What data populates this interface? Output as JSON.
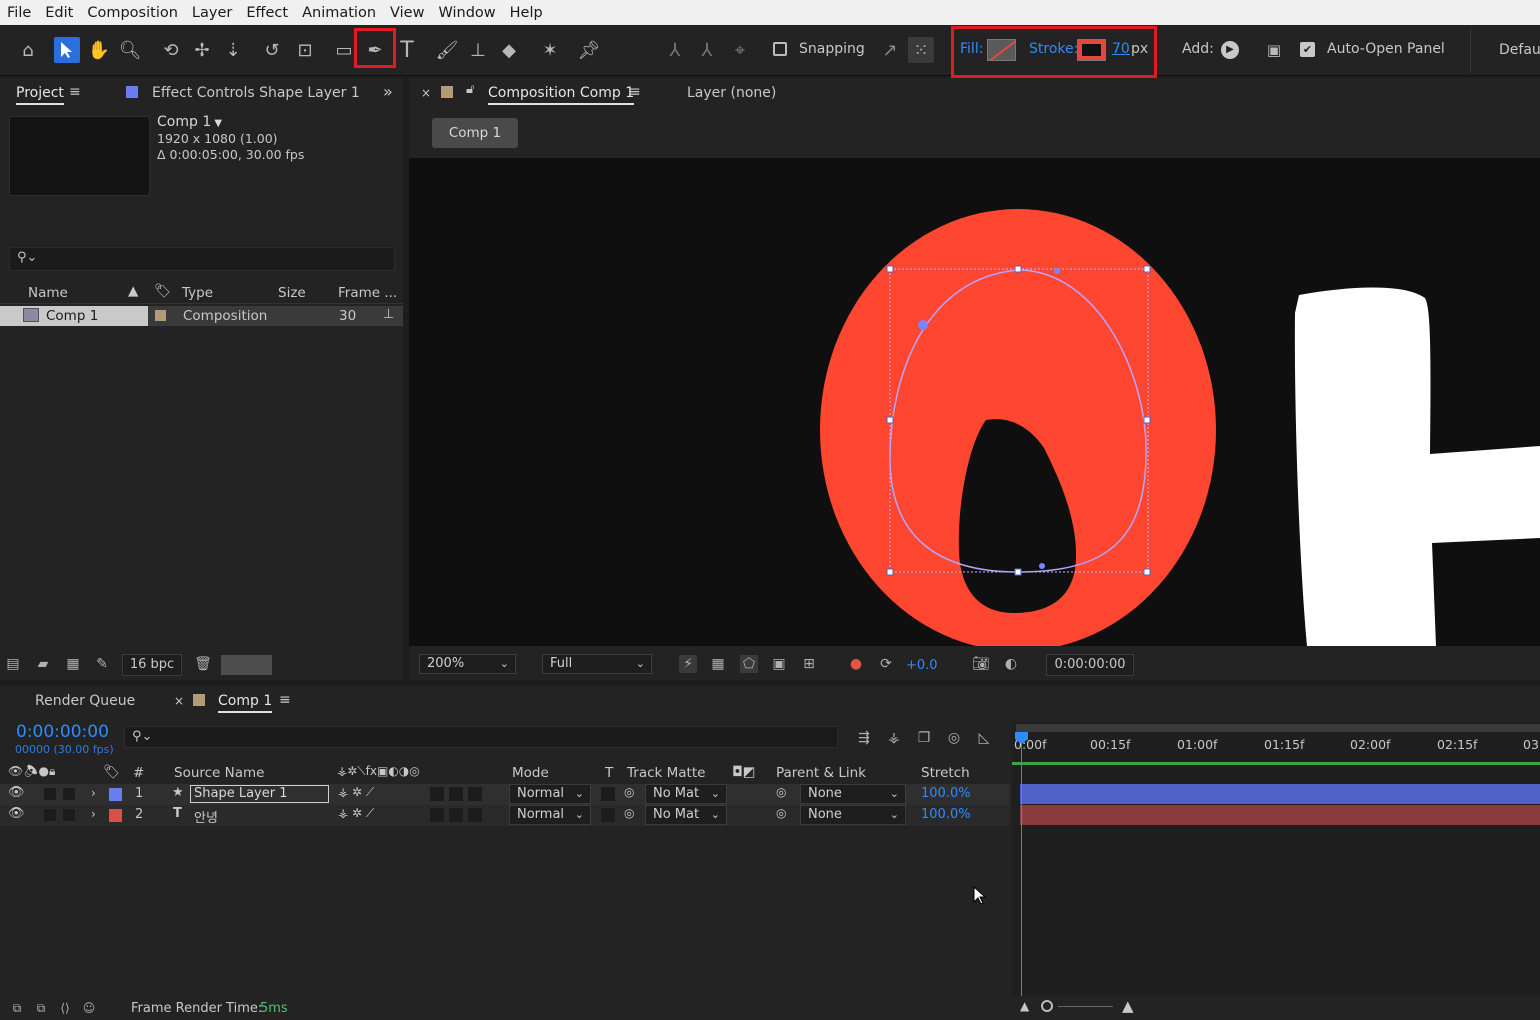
{
  "menu": [
    "File",
    "Edit",
    "Composition",
    "Layer",
    "Effect",
    "Animation",
    "View",
    "Window",
    "Help"
  ],
  "toolbar": {
    "snapping_label": "Snapping",
    "fill_label": "Fill:",
    "stroke_label": "Stroke:",
    "stroke_width": "70",
    "stroke_unit": "px",
    "add_label": "Add:",
    "auto_open_label": "Auto-Open Panel",
    "workspace_label": "Default",
    "fill_color": "#e8453c",
    "stroke_color": "#e8453c"
  },
  "project_panel": {
    "tab_project": "Project",
    "tab_effect_controls": "Effect Controls Shape Layer 1",
    "comp_name": "Comp 1",
    "comp_res": "1920 x 1080 (1.00)",
    "comp_duration": "Δ 0:00:05:00, 30.00 fps",
    "search_placeholder": "",
    "columns": {
      "name": "Name",
      "type": "Type",
      "size": "Size",
      "frame": "Frame ..."
    },
    "items": [
      {
        "name": "Comp 1",
        "type": "Composition",
        "frame": "30"
      }
    ],
    "bpc": "16 bpc"
  },
  "comp_panel": {
    "tab_title": "Composition Comp 1",
    "layer_tab": "Layer (none)",
    "breadcrumb": "Comp 1",
    "zoom": "200%",
    "resolution": "Full",
    "exposure": "+0.0",
    "timecode": "0:00:00:00",
    "canvas_text_o_color": "#ff4630",
    "canvas_text_h_color": "#ffffff"
  },
  "timeline": {
    "tab_render_queue": "Render Queue",
    "tab_comp": "Comp 1",
    "current_time": "0:00:00:00",
    "frame_info": "00000 (30.00 fps)",
    "columns": {
      "hash": "#",
      "source_name": "Source Name",
      "mode": "Mode",
      "t": "T",
      "track_matte": "Track Matte",
      "parent": "Parent & Link",
      "stretch": "Stretch"
    },
    "ruler": [
      "0:00f",
      "00:15f",
      "01:00f",
      "01:15f",
      "02:00f",
      "02:15f",
      "03"
    ],
    "layers": [
      {
        "num": "1",
        "name": "Shape Layer 1",
        "mode": "Normal",
        "matte": "No Mat",
        "parent": "None",
        "stretch": "100.0%",
        "color": "#6b7cf0",
        "bar_color": "#5060c8"
      },
      {
        "num": "2",
        "name": "안녕",
        "mode": "Normal",
        "matte": "No Mat",
        "parent": "None",
        "stretch": "100.0%",
        "color": "#d9504a",
        "bar_color": "#8a3c3c"
      }
    ],
    "frame_render_label": "Frame Render Time:",
    "frame_render_value": "5ms"
  }
}
